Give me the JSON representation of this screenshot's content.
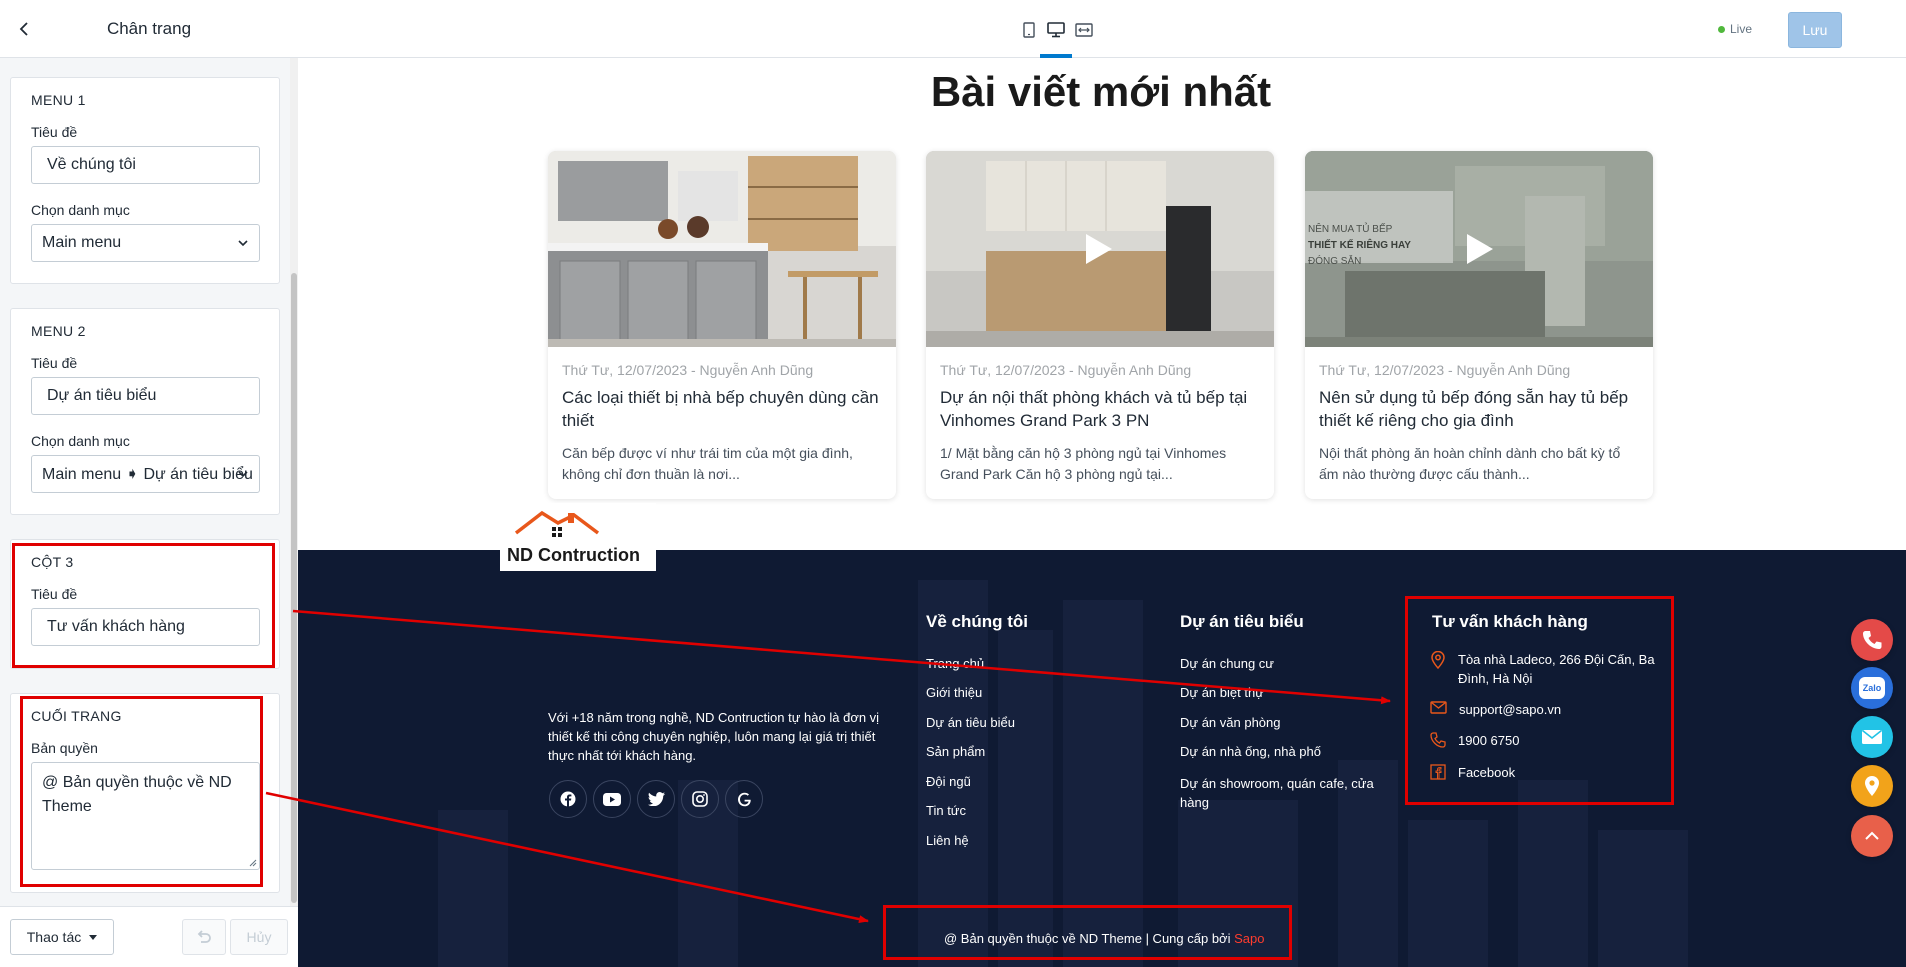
{
  "sidebar": {
    "title": "Chân trang",
    "menu1": {
      "heading": "MENU 1",
      "title_label": "Tiêu đề",
      "title_value": "Về chúng tôi",
      "category_label": "Chọn danh mục",
      "category_value": "Main menu"
    },
    "menu2": {
      "heading": "MENU 2",
      "title_label": "Tiêu đề",
      "title_value": "Dự án tiêu biểu",
      "category_label": "Chọn danh mục",
      "category_value": "Main menu ➧ Dự án tiêu biểu"
    },
    "col3": {
      "heading": "CỘT 3",
      "title_label": "Tiêu đề",
      "title_value": "Tư vấn khách hàng"
    },
    "bottom": {
      "heading": "CUỐI TRANG",
      "copyright_label": "Bản quyền",
      "copyright_value": "@ Bản quyền thuộc về ND Theme"
    },
    "footer": {
      "actions_label": "Thao tác",
      "cancel_label": "Hủy"
    }
  },
  "topbar": {
    "live_label": "Live",
    "save_label": "Lưu"
  },
  "preview": {
    "section_title": "Bài viết mới nhất",
    "posts": [
      {
        "meta": "Thứ Tư, 12/07/2023 - Nguyễn Anh Dũng",
        "title": "Các loại thiết bị nhà bếp chuyên dùng cần thiết",
        "desc": "Căn bếp được ví như trái tim của một gia đình, không chỉ đơn thuần là nơi..."
      },
      {
        "meta": "Thứ Tư, 12/07/2023 - Nguyễn Anh Dũng",
        "title": "Dự án nội thất phòng khách và tủ bếp tại Vinhomes Grand Park 3 PN",
        "desc": "1/ Mặt bằng căn hộ 3 phòng ngủ tại Vinhomes Grand Park Căn hộ 3 phòng ngủ tại..."
      },
      {
        "meta": "Thứ Tư, 12/07/2023 - Nguyễn Anh Dũng",
        "title": "Nên sử dụng tủ bếp đóng sẵn hay tủ bếp thiết kế riêng cho gia đình",
        "desc": "Nội thất phòng ăn hoàn chỉnh dành cho bất kỳ tổ ấm nào thường được cấu thành...",
        "overlay_line1": "NÊN MUA TỦ BẾP",
        "overlay_line2": "THIẾT KẾ RIÊNG HAY",
        "overlay_line3": "ĐÓNG SẴN"
      }
    ],
    "footer": {
      "logo_text": "ND Contruction",
      "about": "Với +18 năm trong nghề, ND Contruction tự hào là đơn vị thiết kế thi công chuyên nghiệp, luôn mang lại giá trị thiết thực nhất tới khách hàng.",
      "col1_title": "Về chúng tôi",
      "col1_links": [
        "Trang chủ",
        "Giới thiệu",
        "Dự án tiêu biểu",
        "Sản phẩm",
        "Đội ngũ",
        "Tin tức",
        "Liên hệ"
      ],
      "col2_title": "Dự án tiêu biểu",
      "col2_links": [
        "Dự án chung cư",
        "Dự án biệt thự",
        "Dự án văn phòng",
        "Dự án nhà ống, nhà phố",
        "Dự án showroom, quán cafe, cửa hàng"
      ],
      "col3_title": "Tư vấn khách hàng",
      "address": "Tòa nhà Ladeco, 266 Đội Cấn, Ba Đình, Hà Nội",
      "email": "support@sapo.vn",
      "phone": "1900 6750",
      "facebook": "Facebook",
      "copyright_text": "@ Bản quyền thuộc về ND Theme | Cung cấp bởi",
      "copyright_brand": "Sapo"
    },
    "zalo_label": "Zalo"
  },
  "colors": {
    "footer_bg": "#0f1a33",
    "accent_blue": "#007ace",
    "annotation_red": "#e00000",
    "brand_red": "#ff3d2e"
  }
}
